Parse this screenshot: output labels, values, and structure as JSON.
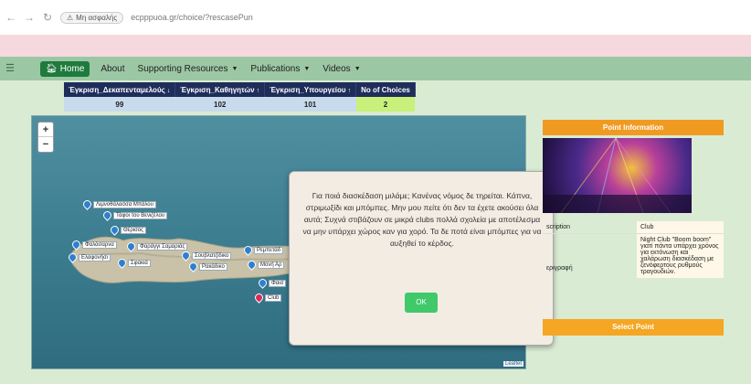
{
  "browser": {
    "security_label": "Μη ασφαλής",
    "url": "ecpppuoa.gr/choice/?rescasePun"
  },
  "navbar": {
    "home_label": "Home",
    "items": [
      {
        "label": "About"
      },
      {
        "label": "Supporting Resources",
        "has_caret": true
      },
      {
        "label": "Publications",
        "has_caret": true
      },
      {
        "label": "Videos",
        "has_caret": true
      }
    ]
  },
  "counts_table": {
    "headers": [
      "Έγκριση_Δεκαπενταμελούς",
      "Έγκριση_Καθηγητών",
      "Έγκριση_Υπουργείου",
      "No of Choices"
    ],
    "values": [
      "99",
      "102",
      "101",
      "2"
    ]
  },
  "map": {
    "markers": [
      {
        "label": "Λιμνοθάλασσα Μπάλου"
      },
      {
        "label": "Τάφοι του Βενιζέλου"
      },
      {
        "label": "Θέρισος"
      },
      {
        "label": "Φαλάσαρνα"
      },
      {
        "label": "Φαράγγι Σαμαριάς"
      },
      {
        "label": "Ελαφονήσι"
      },
      {
        "label": "Σφακιά"
      },
      {
        "label": "Σουβλατζίδικο"
      },
      {
        "label": "Ρακάδικο"
      },
      {
        "label": "Ρεμπετάδ"
      },
      {
        "label": "Μονή Αρ"
      },
      {
        "label": "Φαισ"
      },
      {
        "label": "Club"
      }
    ],
    "attribution": "Leaflet"
  },
  "dialog": {
    "text": "Για ποιά διασκέδαση μιλάμε; Κανένας νόμος δε τηρείται. Κάπνα, στριμωξίδι και μπόμπες. Μην μου πείτε ότι δεν τα έχετε ακούσει όλα αυτά; Συχνά στιβάζουν σε μικρά clubs πολλά σχολεία με αποτέλεσμα να μην υπάρχει χώρος καν για χορό. Τα δε ποτά είναι μπόμπες για να αυξηθεί το κέρδος.",
    "ok_label": "OK"
  },
  "side_panel": {
    "header": "Point Information",
    "rows": [
      {
        "label": "scription",
        "value": "Club"
      },
      {
        "label": "εριγραφή",
        "value": "Night Club \"Boom boom\" γιατί πάντα υπάρχει χρόνος για εκτόνωση και χαλάρωση διασκέδαση με ξενόφερτους ρυθμούς τραγουδιών."
      }
    ],
    "select_label": "Select Point"
  }
}
